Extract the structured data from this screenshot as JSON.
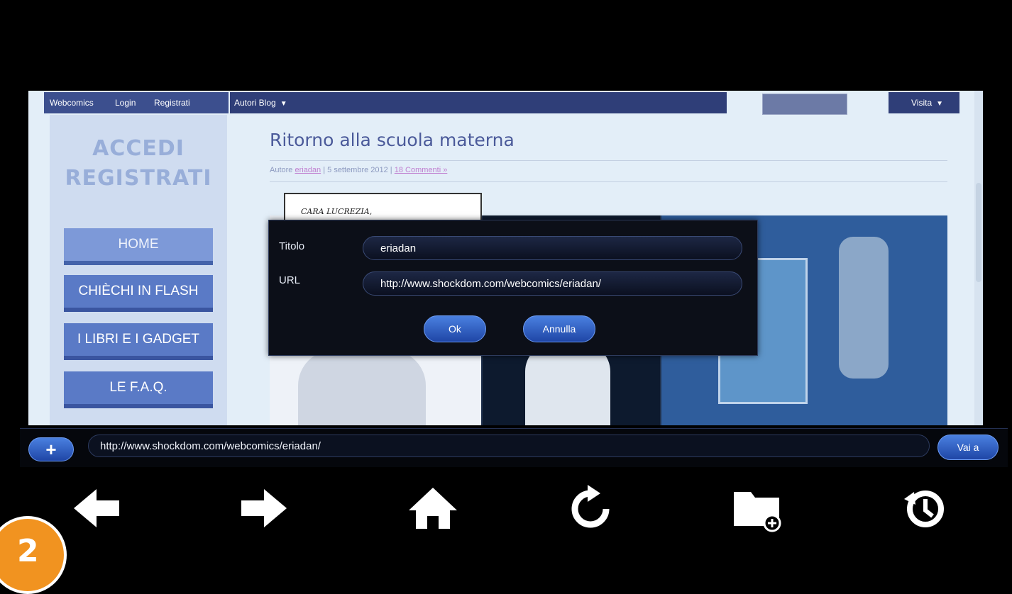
{
  "topnav": {
    "links": [
      "Webcomics",
      "Login",
      "Registrati",
      "Autori Blog"
    ],
    "visita": "Visita"
  },
  "sidebar": {
    "accedi": "ACCEDI",
    "registrati": "REGISTRATI",
    "menu": [
      "HOME",
      "CHIÈCHI IN FLASH",
      "I LIBRI E I GADGET",
      "LE F.A.Q."
    ]
  },
  "article": {
    "title": "Ritorno alla scuola materna",
    "meta_prefix": "Autore ",
    "author": "eriadan",
    "meta_date": " | 5 settembre 2012 | ",
    "comments": "18 Commenti »",
    "speech": "CARA LUCREZIA,"
  },
  "dialog": {
    "titolo_label": "Titolo",
    "titolo_value": "eriadan",
    "url_label": "URL",
    "url_value": "http://www.shockdom.com/webcomics/eriadan/",
    "ok": "Ok",
    "annulla": "Annulla"
  },
  "urlbar": {
    "plus": "+",
    "value": "http://www.shockdom.com/webcomics/eriadan/",
    "go": "Vai a"
  },
  "toolbar": [
    "back-arrow-icon",
    "forward-arrow-icon",
    "home-icon",
    "refresh-icon",
    "folder-add-icon",
    "history-icon"
  ],
  "badge": "2",
  "colors": {
    "accent": "#2f5fc4",
    "badge": "#f19320"
  }
}
